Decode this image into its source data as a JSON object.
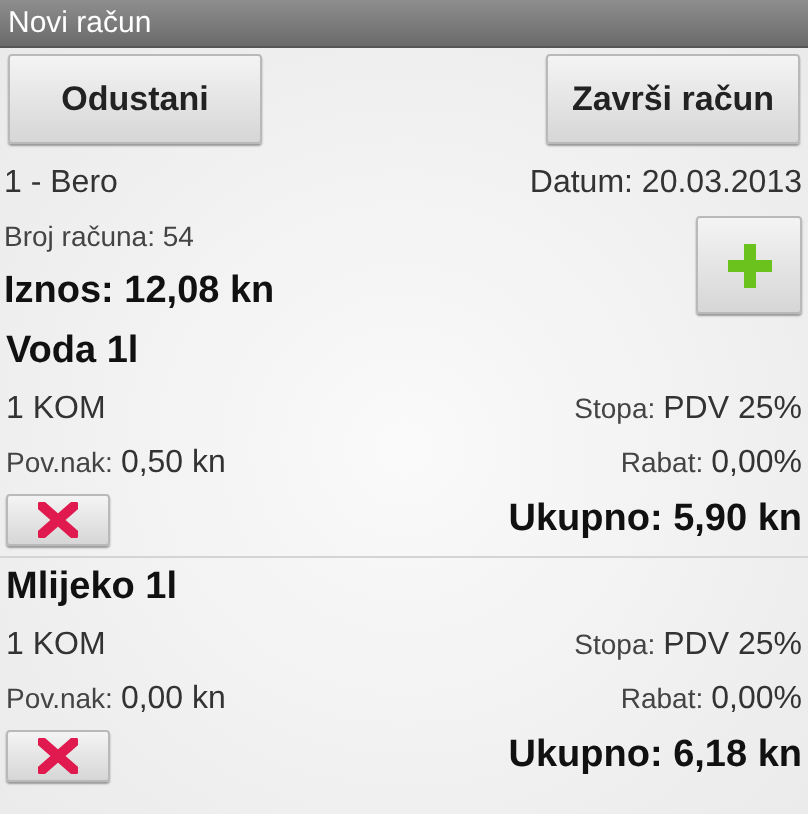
{
  "window": {
    "title": "Novi račun"
  },
  "buttons": {
    "cancel": "Odustani",
    "finish": "Završi račun"
  },
  "customer": "1 - Bero",
  "date": "Datum: 20.03.2013",
  "invoice_number": "Broj računa: 54",
  "amount": "Iznos: 12,08 kn",
  "items": [
    {
      "name": "Voda 1l",
      "quantity": "1 KOM",
      "rate_label": "Stopa:",
      "rate": "PDV 25%",
      "deposit_label": "Pov.nak:",
      "deposit": "0,50 kn",
      "discount_label": "Rabat:",
      "discount": "0,00%",
      "total": "Ukupno: 5,90 kn"
    },
    {
      "name": "Mlijeko 1l",
      "quantity": "1 KOM",
      "rate_label": "Stopa:",
      "rate": "PDV 25%",
      "deposit_label": "Pov.nak:",
      "deposit": "0,00 kn",
      "discount_label": "Rabat:",
      "discount": "0,00%",
      "total": "Ukupno: 6,18 kn"
    }
  ]
}
